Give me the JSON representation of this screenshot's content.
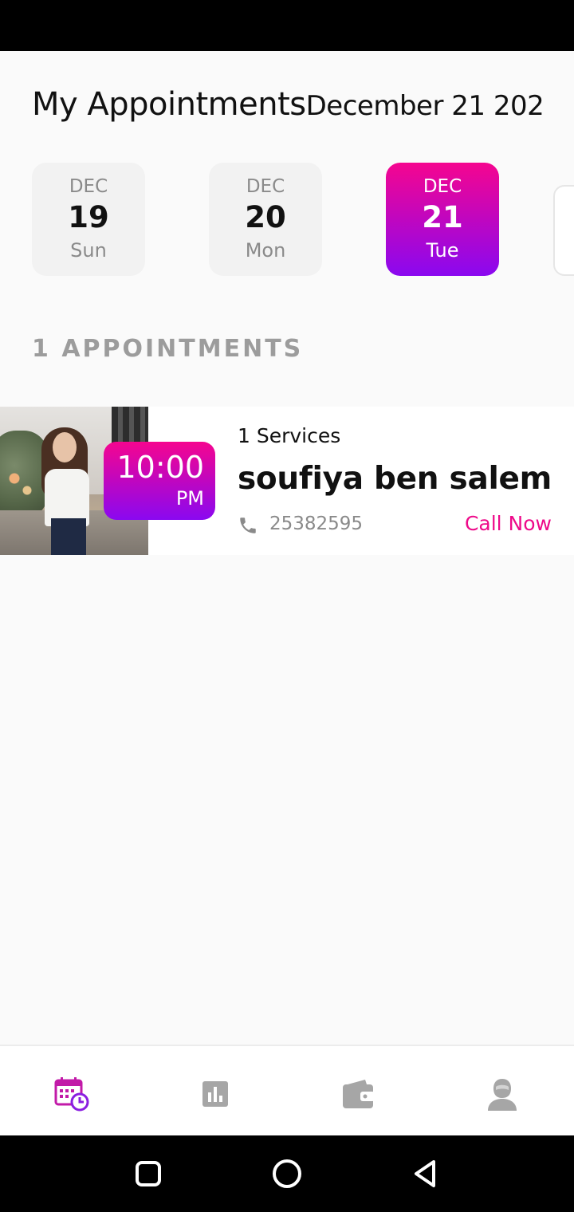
{
  "header": {
    "title": "My Appointments",
    "date": "December 21 202"
  },
  "days": [
    {
      "month": "DEC",
      "day": "19",
      "weekday": "Sun",
      "selected": false
    },
    {
      "month": "DEC",
      "day": "20",
      "weekday": "Mon",
      "selected": false
    },
    {
      "month": "DEC",
      "day": "21",
      "weekday": "Tue",
      "selected": true
    }
  ],
  "appointments_count_label": "1 APPOINTMENTS",
  "appointment": {
    "time": "10:00",
    "ampm": "PM",
    "services": "1 Services",
    "client_name": "soufiya ben salem",
    "phone": "25382595",
    "call_label": "Call Now"
  },
  "bottom_nav": {
    "items": [
      {
        "icon": "calendar-clock-icon",
        "active": true
      },
      {
        "icon": "bar-chart-icon",
        "active": false
      },
      {
        "icon": "wallet-icon",
        "active": false
      },
      {
        "icon": "profile-icon",
        "active": false
      }
    ]
  },
  "colors": {
    "accent_start": "#f5058f",
    "accent_end": "#8a08f0",
    "call_link": "#ee0a8a",
    "inactive_icon": "#9e9e9e"
  }
}
